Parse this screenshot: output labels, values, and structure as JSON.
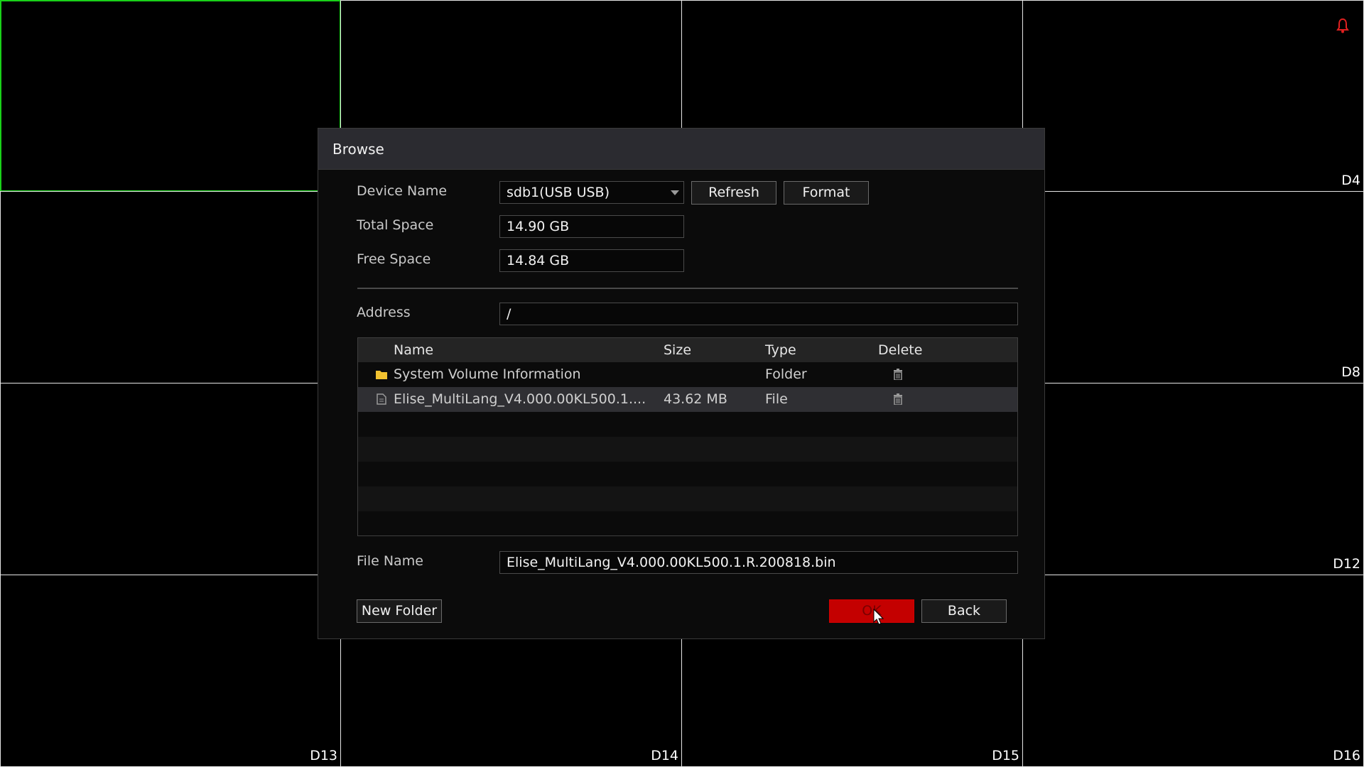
{
  "channels": {
    "d4": "D4",
    "d8": "D8",
    "d12": "D12",
    "d13": "D13",
    "d14": "D14",
    "d15": "D15",
    "d16": "D16"
  },
  "colors": {
    "selected_border": "#19d119",
    "ok_button": "#c40000",
    "alarm_icon": "#e02020"
  },
  "dialog": {
    "title": "Browse",
    "device_name_label": "Device Name",
    "device_name_value": "sdb1(USB USB)",
    "refresh_label": "Refresh",
    "format_label": "Format",
    "total_space_label": "Total Space",
    "total_space_value": "14.90 GB",
    "free_space_label": "Free Space",
    "free_space_value": "14.84 GB",
    "address_label": "Address",
    "address_value": "/",
    "table": {
      "headers": {
        "name": "Name",
        "size": "Size",
        "type": "Type",
        "delete": "Delete"
      },
      "rows": [
        {
          "icon": "folder-icon",
          "name": "System Volume Information",
          "size": "",
          "type": "Folder"
        },
        {
          "icon": "file-icon",
          "name": "Elise_MultiLang_V4.000.00KL500.1....",
          "size": "43.62 MB",
          "type": "File"
        }
      ]
    },
    "file_name_label": "File Name",
    "file_name_value": "Elise_MultiLang_V4.000.00KL500.1.R.200818.bin",
    "new_folder_label": "New Folder",
    "ok_label": "OK",
    "back_label": "Back"
  }
}
